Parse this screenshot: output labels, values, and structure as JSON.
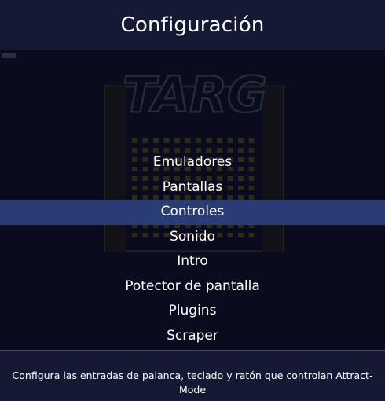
{
  "header": {
    "title": "Configuración"
  },
  "background": {
    "logo_text": "TARG"
  },
  "menu": {
    "selected_index": 2,
    "items": [
      {
        "label": "Emuladores"
      },
      {
        "label": "Pantallas"
      },
      {
        "label": "Controles"
      },
      {
        "label": "Sonido"
      },
      {
        "label": "Intro"
      },
      {
        "label": "Potector de pantalla"
      },
      {
        "label": "Plugins"
      },
      {
        "label": "Scraper"
      }
    ]
  },
  "footer": {
    "help_text": "Configura las entradas de palanca, teclado y ratón que controlan Attract-Mode"
  },
  "colors": {
    "background": "#0b0b1e",
    "header_bg": "#141a36",
    "accent_line": "#3a4a80",
    "selection": "#2a3c74",
    "text": "#ffffff"
  }
}
